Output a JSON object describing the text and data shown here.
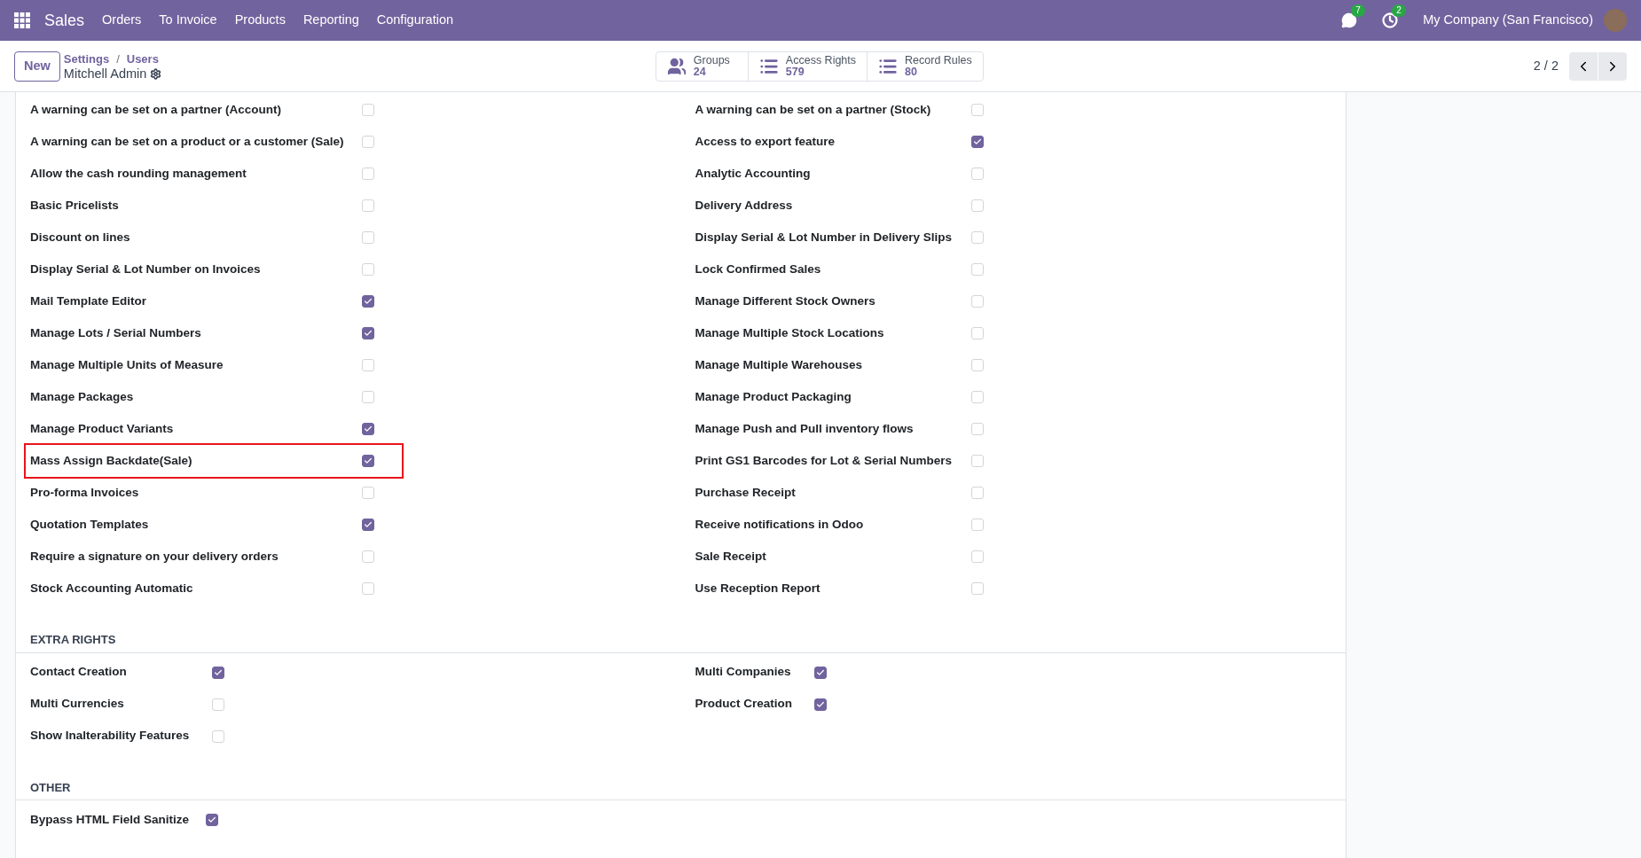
{
  "navbar": {
    "app": "Sales",
    "menu": [
      "Orders",
      "To Invoice",
      "Products",
      "Reporting",
      "Configuration"
    ],
    "messages_badge": "7",
    "activities_badge": "2",
    "company": "My Company (San Francisco)"
  },
  "control_panel": {
    "new_button": "New",
    "breadcrumbs": [
      "Settings",
      "Users"
    ],
    "breadcrumb_separator": "/",
    "record_title": "Mitchell Admin",
    "smart_buttons": [
      {
        "label": "Groups",
        "count": "24"
      },
      {
        "label": "Access Rights",
        "count": "579"
      },
      {
        "label": "Record Rules",
        "count": "80"
      }
    ],
    "pager": "2 / 2"
  },
  "technical_rights": {
    "left": [
      {
        "label": "A warning can be set on a partner (Account)",
        "checked": false,
        "highlighted": false
      },
      {
        "label": "A warning can be set on a product or a customer (Sale)",
        "checked": false,
        "highlighted": false
      },
      {
        "label": "Allow the cash rounding management",
        "checked": false,
        "highlighted": false
      },
      {
        "label": "Basic Pricelists",
        "checked": false,
        "highlighted": false
      },
      {
        "label": "Discount on lines",
        "checked": false,
        "highlighted": false
      },
      {
        "label": "Display Serial & Lot Number on Invoices",
        "checked": false,
        "highlighted": false
      },
      {
        "label": "Mail Template Editor",
        "checked": true,
        "highlighted": false
      },
      {
        "label": "Manage Lots / Serial Numbers",
        "checked": true,
        "highlighted": false
      },
      {
        "label": "Manage Multiple Units of Measure",
        "checked": false,
        "highlighted": false
      },
      {
        "label": "Manage Packages",
        "checked": false,
        "highlighted": false
      },
      {
        "label": "Manage Product Variants",
        "checked": true,
        "highlighted": false
      },
      {
        "label": "Mass Assign Backdate(Sale)",
        "checked": true,
        "highlighted": true
      },
      {
        "label": "Pro-forma Invoices",
        "checked": false,
        "highlighted": false
      },
      {
        "label": "Quotation Templates",
        "checked": true,
        "highlighted": false
      },
      {
        "label": "Require a signature on your delivery orders",
        "checked": false,
        "highlighted": false
      },
      {
        "label": "Stock Accounting Automatic",
        "checked": false,
        "highlighted": false
      }
    ],
    "right": [
      {
        "label": "A warning can be set on a partner (Stock)",
        "checked": false,
        "highlighted": false
      },
      {
        "label": "Access to export feature",
        "checked": true,
        "highlighted": false
      },
      {
        "label": "Analytic Accounting",
        "checked": false,
        "highlighted": false
      },
      {
        "label": "Delivery Address",
        "checked": false,
        "highlighted": false
      },
      {
        "label": "Display Serial & Lot Number in Delivery Slips",
        "checked": false,
        "highlighted": false
      },
      {
        "label": "Lock Confirmed Sales",
        "checked": false,
        "highlighted": false
      },
      {
        "label": "Manage Different Stock Owners",
        "checked": false,
        "highlighted": false
      },
      {
        "label": "Manage Multiple Stock Locations",
        "checked": false,
        "highlighted": false
      },
      {
        "label": "Manage Multiple Warehouses",
        "checked": false,
        "highlighted": false
      },
      {
        "label": "Manage Product Packaging",
        "checked": false,
        "highlighted": false
      },
      {
        "label": "Manage Push and Pull inventory flows",
        "checked": false,
        "highlighted": false
      },
      {
        "label": "Print GS1 Barcodes for Lot & Serial Numbers",
        "checked": false,
        "highlighted": false
      },
      {
        "label": "Purchase Receipt",
        "checked": false,
        "highlighted": false
      },
      {
        "label": "Receive notifications in Odoo",
        "checked": false,
        "highlighted": false
      },
      {
        "label": "Sale Receipt",
        "checked": false,
        "highlighted": false
      },
      {
        "label": "Use Reception Report",
        "checked": false,
        "highlighted": false
      }
    ]
  },
  "sections": [
    {
      "title": "EXTRA RIGHTS",
      "left": [
        {
          "label": "Contact Creation",
          "checked": true
        },
        {
          "label": "Multi Currencies",
          "checked": false
        },
        {
          "label": "Show Inalterability Features",
          "checked": false
        }
      ],
      "right": [
        {
          "label": "Multi Companies",
          "checked": true
        },
        {
          "label": "Product Creation",
          "checked": true
        }
      ]
    },
    {
      "title": "OTHER",
      "left": [
        {
          "label": "Bypass HTML Field Sanitize",
          "checked": true
        }
      ]
    }
  ]
}
